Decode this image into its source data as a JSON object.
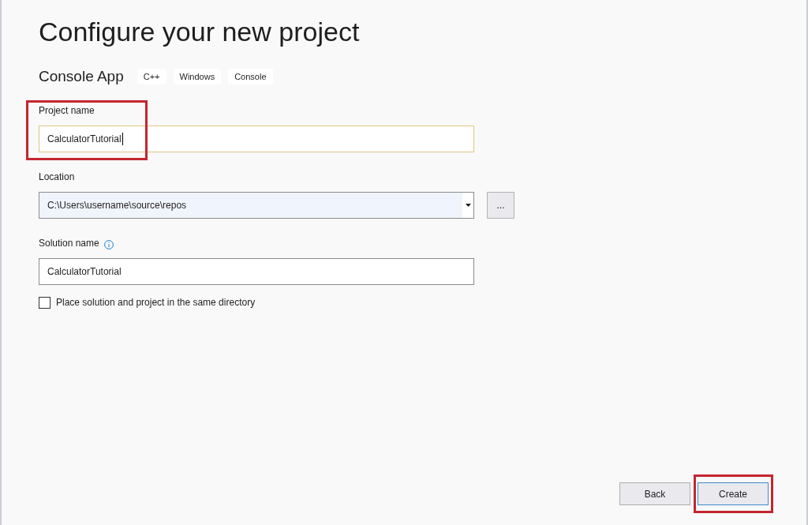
{
  "page": {
    "title": "Configure your new project"
  },
  "template": {
    "name": "Console App",
    "tags": [
      "C++",
      "Windows",
      "Console"
    ]
  },
  "fields": [
    {
      "kind": "text",
      "label": "Project name",
      "value": "CalculatorTutorial",
      "focused": true,
      "info": false,
      "highlighted": true
    },
    {
      "kind": "dropdown",
      "label": "Location",
      "value": "C:\\Users\\username\\source\\repos",
      "browse_button": "...",
      "focused": false,
      "info": false,
      "highlighted": false
    },
    {
      "kind": "text",
      "label": "Solution name",
      "value": "CalculatorTutorial",
      "focused": false,
      "info": true,
      "highlighted": false
    }
  ],
  "options": [
    {
      "label": "Place solution and project in the same directory",
      "checked": false
    }
  ],
  "buttons": [
    {
      "label": "Back",
      "default": false,
      "highlighted": false
    },
    {
      "label": "Create",
      "default": true,
      "highlighted": true
    }
  ]
}
